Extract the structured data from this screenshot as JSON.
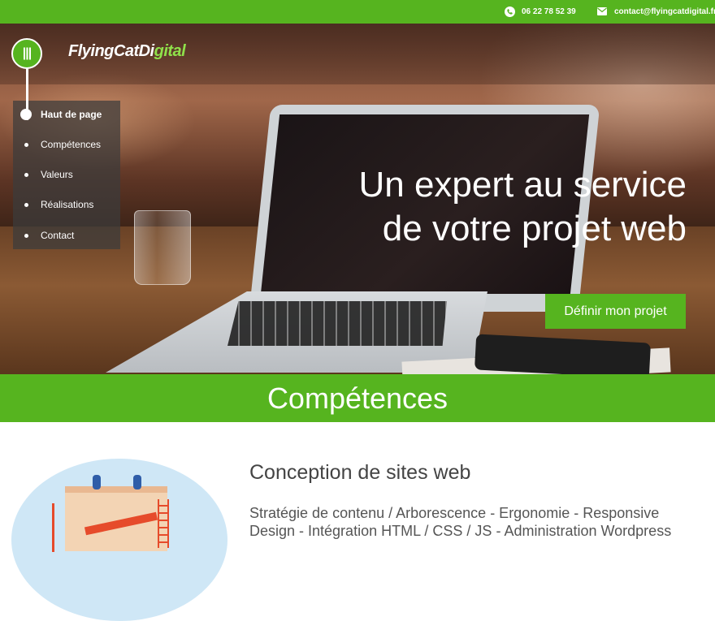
{
  "topbar": {
    "phone": "06 22 78 52 39",
    "email": "contact@flyingcatdigital.fr",
    "phone_icon": "phone-icon",
    "email_icon": "envelope-icon"
  },
  "brand": {
    "logo_mark": "|||",
    "name_part1": "FlyingCatDi",
    "name_part2": "gital"
  },
  "nav": {
    "items": [
      {
        "label": "Haut de page",
        "active": true
      },
      {
        "label": "Compétences",
        "active": false
      },
      {
        "label": "Valeurs",
        "active": false
      },
      {
        "label": "Réalisations",
        "active": false
      },
      {
        "label": "Contact",
        "active": false
      }
    ]
  },
  "hero": {
    "line1": "Un expert au service",
    "line2": "de votre projet web",
    "cta": "Définir mon projet"
  },
  "section": {
    "title": "Compétences"
  },
  "skill": {
    "title": "Conception de sites web",
    "description": "Stratégie de contenu / Arborescence - Ergonomie - Responsive Design - Intégration HTML / CSS / JS - Administration Wordpress"
  },
  "colors": {
    "brand_green": "#56b41f"
  }
}
